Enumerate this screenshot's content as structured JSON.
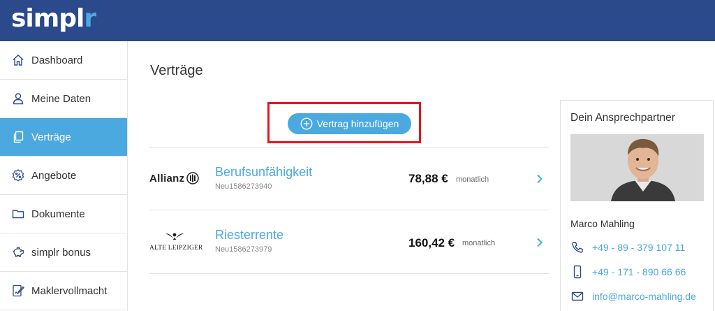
{
  "app": {
    "logo_main": "simpl",
    "logo_accent": "r"
  },
  "colors": {
    "brand_dark": "#2a4a8c",
    "accent": "#4ba9e0",
    "highlight": "#e8141e"
  },
  "sidebar": {
    "items": [
      {
        "label": "Dashboard",
        "icon": "home-icon",
        "active": false
      },
      {
        "label": "Meine Daten",
        "icon": "user-icon",
        "active": false
      },
      {
        "label": "Verträge",
        "icon": "documents-icon",
        "active": true
      },
      {
        "label": "Angebote",
        "icon": "percent-badge-icon",
        "active": false
      },
      {
        "label": "Dokumente",
        "icon": "folder-icon",
        "active": false
      },
      {
        "label": "simplr bonus",
        "icon": "piggy-bank-icon",
        "active": false
      },
      {
        "label": "Maklervollmacht",
        "icon": "signature-document-icon",
        "active": false
      }
    ]
  },
  "main": {
    "title": "Verträge",
    "add_button_label": "Vertrag hinzufügen",
    "contracts": [
      {
        "insurer": "Allianz",
        "insurer_logo": "allianz-logo",
        "name": "Berufsunfähigkeit",
        "number": "Neu1586273940",
        "amount": "78,88 €",
        "period": "monatlich"
      },
      {
        "insurer": "ALTE LEIPZIGER",
        "insurer_logo": "alte-leipziger-logo",
        "name": "Riesterrente",
        "number": "Neu1586273979",
        "amount": "160,42 €",
        "period": "monatlich"
      }
    ]
  },
  "contact": {
    "header": "Dein Ansprechpartner",
    "name": "Marco Mahling",
    "phone": "+49 - 89 - 379 107 11",
    "mobile": "+49 - 171 - 890 66 66",
    "email": "info@marco-mahling.de"
  }
}
